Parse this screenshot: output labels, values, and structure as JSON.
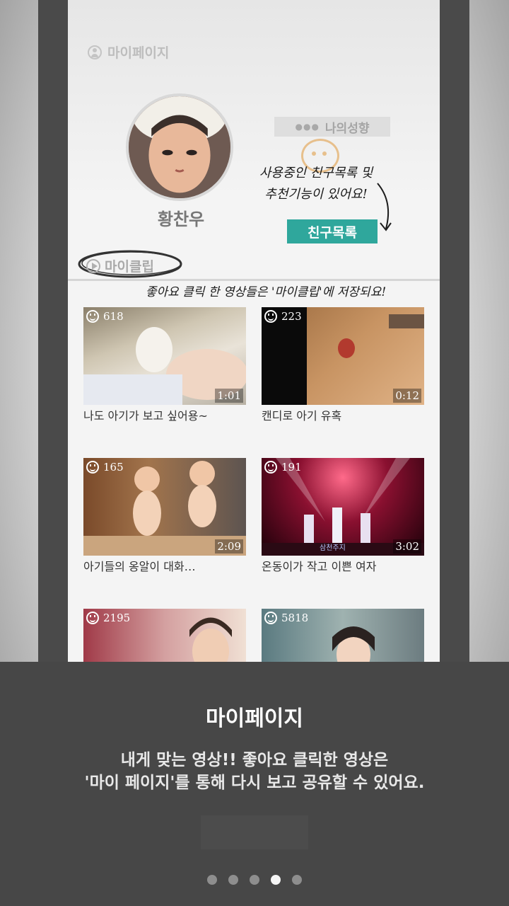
{
  "screen": {
    "header_title": "마이페이지",
    "profile": {
      "name": "황찬우"
    },
    "tendency_button": "나의성향",
    "friends_note": [
      "사용중인 친구목록 및",
      "추천기능이 있어요!"
    ],
    "friends_button": "친구목록",
    "myclip_tab": "마이클립",
    "myclip_note": "좋아요 클릭 한 영상들은 '마이클립'에 저장되요!",
    "videos": [
      {
        "likes": "618",
        "duration": "1:01",
        "title": "나도 아기가 보고 싶어용~"
      },
      {
        "likes": "223",
        "duration": "0:12",
        "title": "캔디로 아기 유혹"
      },
      {
        "likes": "165",
        "duration": "2:09",
        "title": "아기들의 옹알이 대화…"
      },
      {
        "likes": "191",
        "duration": "3:02",
        "title": "온동이가 작고 이쁜 여자"
      },
      {
        "likes": "2195",
        "duration": "",
        "title": ""
      },
      {
        "likes": "5818",
        "duration": "",
        "title": ""
      }
    ],
    "thumb_overlay_text": "삼천주지"
  },
  "panel": {
    "title": "마이페이지",
    "description_line1": "내게 맞는 영상!! 좋아요 클릭한 영상은",
    "description_line2": "'마이 페이지'를 통해 다시 보고 공유할 수 있어요."
  },
  "pager": {
    "total": 5,
    "active_index": 3
  },
  "colors": {
    "accent": "#2fa79c",
    "panel_bg": "#474747",
    "side_bar": "#4a4a4a"
  }
}
